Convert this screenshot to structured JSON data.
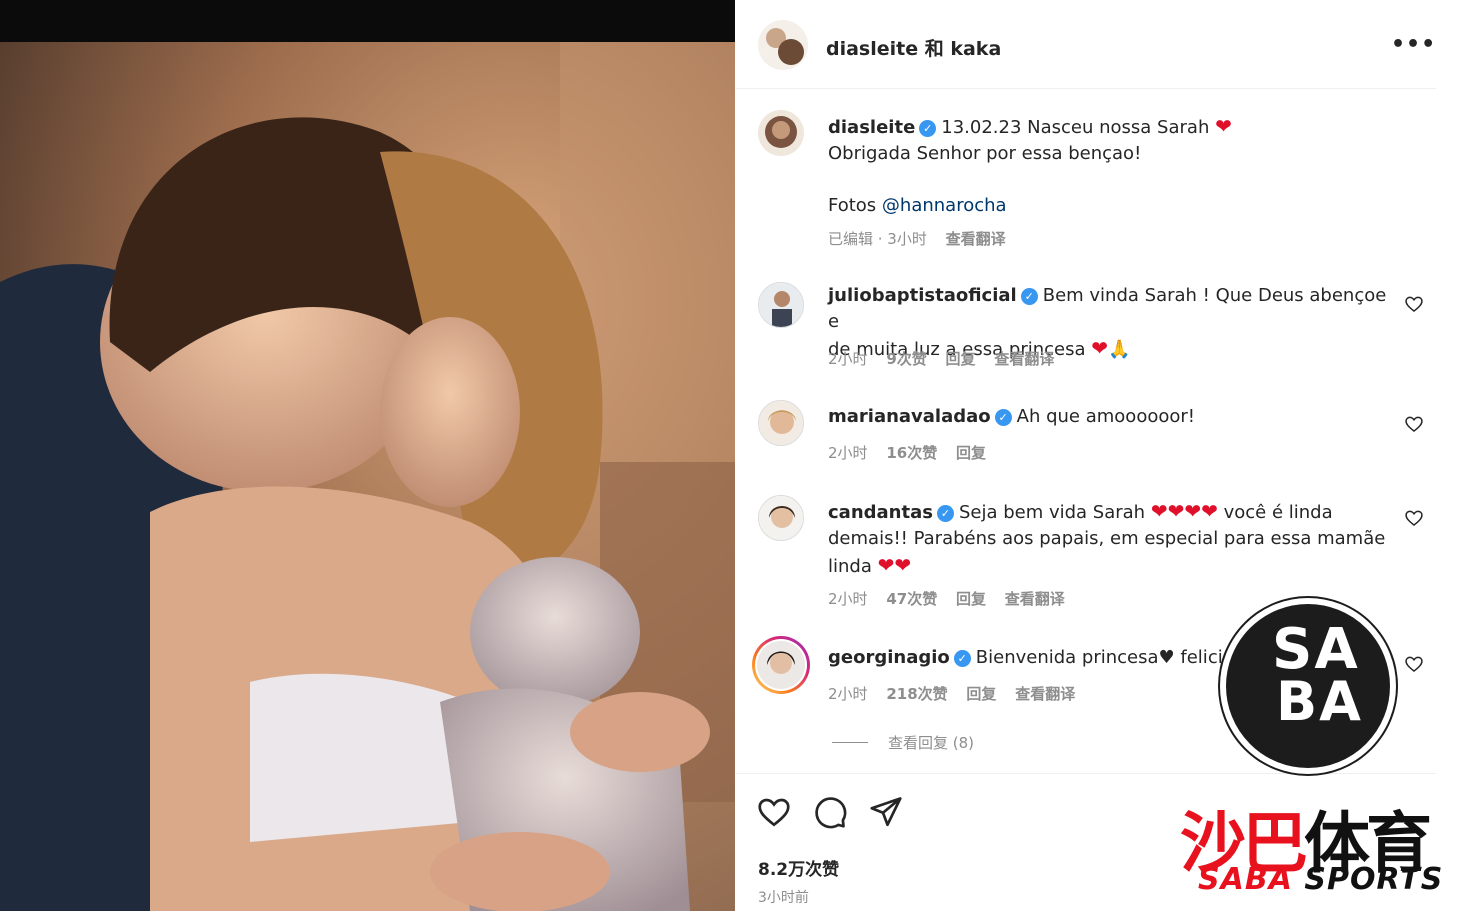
{
  "post": {
    "header_user": "diasleite 和 kaka",
    "more_icon": "more-horizontal-icon",
    "caption": {
      "username": "diasleite",
      "line1": "13.02.23 Nasceu nossa Sarah",
      "line2": "Obrigada Senhor por essa bençao!",
      "fotos_label": "Fotos",
      "mention": "@hannarocha",
      "edited": "已编辑 · 3小时",
      "translate": "查看翻译"
    }
  },
  "comments": [
    {
      "username": "juliobaptistaoficial",
      "text_line1": "Bem vinda Sarah ! Que Deus abençoe e",
      "text_line2": "de muita luz a essa princesa",
      "emoji_tail": "🙏",
      "time": "2小时",
      "likes": "9次赞",
      "reply": "回复",
      "translate": "查看翻译"
    },
    {
      "username": "marianavaladao",
      "text_line1": "Ah que amoooooor!",
      "time": "2小时",
      "likes": "16次赞",
      "reply": "回复"
    },
    {
      "username": "candantas",
      "text_line1a": "Seja bem vida Sarah",
      "text_line1b": "você é linda",
      "text_line2": "demais!! Parabéns aos papais, em especial para essa mamãe",
      "text_line3": "linda",
      "time": "2小时",
      "likes": "47次赞",
      "reply": "回复",
      "translate": "查看翻译"
    },
    {
      "username": "georginagio",
      "text_line1": "Bienvenida princesa♥ felicidades",
      "time": "2小时",
      "likes": "218次赞",
      "reply": "回复",
      "translate": "查看翻译",
      "view_replies": "查看回复 (8)"
    }
  ],
  "footer": {
    "like_icon": "heart-icon",
    "comment_icon": "comment-icon",
    "share_icon": "send-icon",
    "likes_total": "8.2万次赞",
    "time_ago": "3小时前"
  },
  "watermark": {
    "logo_line1": "SA",
    "logo_line2": "BA",
    "cn_red": "沙巴",
    "cn_dark": "体育",
    "en_red": "SABA",
    "en_dark": "SPORTS"
  },
  "colors": {
    "verified": "#3897f0",
    "heart": "#e0102a",
    "mention": "#00376b",
    "brand_red": "#e8121e"
  }
}
